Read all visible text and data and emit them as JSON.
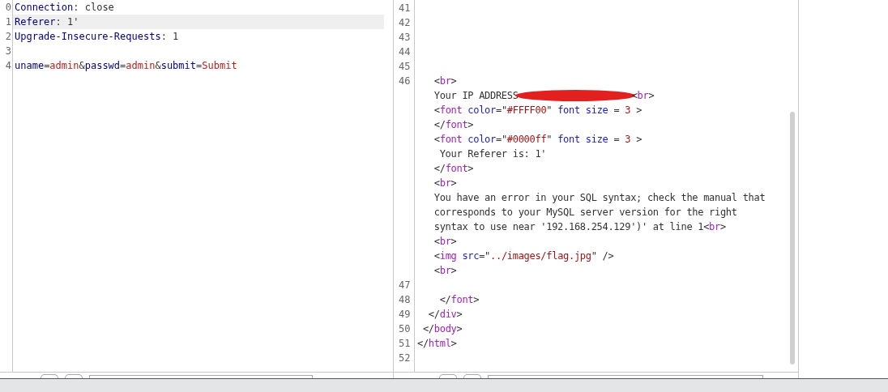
{
  "request_editor": {
    "lines": [
      {
        "number": "0",
        "selected": false,
        "tokens": [
          {
            "kind": "key",
            "text": "Connection"
          },
          {
            "kind": "punct",
            "text": ": "
          },
          {
            "kind": "plain",
            "text": "close"
          }
        ]
      },
      {
        "number": "1",
        "selected": true,
        "tokens": [
          {
            "kind": "key",
            "text": "Referer"
          },
          {
            "kind": "punct",
            "text": ": "
          },
          {
            "kind": "plain",
            "text": "1'"
          }
        ]
      },
      {
        "number": "2",
        "selected": false,
        "tokens": [
          {
            "kind": "key",
            "text": "Upgrade-Insecure-Requests"
          },
          {
            "kind": "punct",
            "text": ": "
          },
          {
            "kind": "plain",
            "text": "1"
          }
        ]
      },
      {
        "number": "3",
        "selected": false
      },
      {
        "number": "4",
        "selected": false,
        "tokens": [
          {
            "kind": "key",
            "text": "uname"
          },
          {
            "kind": "punct",
            "text": "="
          },
          {
            "kind": "value",
            "text": "admin"
          },
          {
            "kind": "punct",
            "text": "&"
          },
          {
            "kind": "key",
            "text": "passwd"
          },
          {
            "kind": "punct",
            "text": "="
          },
          {
            "kind": "value",
            "text": "admin"
          },
          {
            "kind": "punct",
            "text": "&"
          },
          {
            "kind": "key",
            "text": "submit"
          },
          {
            "kind": "punct",
            "text": "="
          },
          {
            "kind": "value",
            "text": "Submit"
          }
        ]
      }
    ]
  },
  "response_editor": {
    "lines": [
      {
        "number": "41"
      },
      {
        "number": "42"
      },
      {
        "number": "43"
      },
      {
        "number": "44"
      },
      {
        "number": "45"
      },
      {
        "number": "46",
        "tokens": [
          {
            "kind": "plain",
            "text": "   <"
          },
          {
            "kind": "tag",
            "text": "br"
          },
          {
            "kind": "plain",
            "text": ">"
          }
        ]
      },
      {
        "tokens": [
          {
            "kind": "plain",
            "text": "   Your IP ADDRESS"
          },
          {
            "kind": "redaction"
          },
          {
            "kind": "plain",
            "text": "<"
          },
          {
            "kind": "tag",
            "text": "br"
          },
          {
            "kind": "plain",
            "text": ">"
          }
        ]
      },
      {
        "tokens": [
          {
            "kind": "plain",
            "text": "   <"
          },
          {
            "kind": "tag",
            "text": "font"
          },
          {
            "kind": "attr",
            "text": " color"
          },
          {
            "kind": "plain",
            "text": "=\""
          },
          {
            "kind": "value",
            "text": "#FFFF00"
          },
          {
            "kind": "plain",
            "text": "\" "
          },
          {
            "kind": "attr",
            "text": "font size"
          },
          {
            "kind": "plain",
            "text": " = "
          },
          {
            "kind": "value",
            "text": "3"
          },
          {
            "kind": "plain",
            "text": " >"
          }
        ]
      },
      {
        "tokens": [
          {
            "kind": "plain",
            "text": "   </"
          },
          {
            "kind": "tag",
            "text": "font"
          },
          {
            "kind": "plain",
            "text": ">"
          }
        ]
      },
      {
        "tokens": [
          {
            "kind": "plain",
            "text": "   <"
          },
          {
            "kind": "tag",
            "text": "font"
          },
          {
            "kind": "attr",
            "text": " color"
          },
          {
            "kind": "plain",
            "text": "=\""
          },
          {
            "kind": "value",
            "text": "#0000ff"
          },
          {
            "kind": "plain",
            "text": "\" "
          },
          {
            "kind": "attr",
            "text": "font size"
          },
          {
            "kind": "plain",
            "text": " = "
          },
          {
            "kind": "value",
            "text": "3"
          },
          {
            "kind": "plain",
            "text": " >"
          }
        ]
      },
      {
        "tokens": [
          {
            "kind": "plain",
            "text": "    Your Referer is: 1'"
          }
        ]
      },
      {
        "tokens": [
          {
            "kind": "plain",
            "text": "   </"
          },
          {
            "kind": "tag",
            "text": "font"
          },
          {
            "kind": "plain",
            "text": ">"
          }
        ]
      },
      {
        "tokens": [
          {
            "kind": "plain",
            "text": "   <"
          },
          {
            "kind": "tag",
            "text": "br"
          },
          {
            "kind": "plain",
            "text": ">"
          }
        ]
      },
      {
        "tokens": [
          {
            "kind": "plain",
            "text": "   You have an error in your SQL syntax; check the manual that"
          }
        ]
      },
      {
        "tokens": [
          {
            "kind": "plain",
            "text": "   corresponds to your MySQL server version for the right"
          }
        ]
      },
      {
        "tokens": [
          {
            "kind": "plain",
            "text": "   syntax to use near '192.168.254.129')' at line 1<"
          },
          {
            "kind": "tag",
            "text": "br"
          },
          {
            "kind": "plain",
            "text": ">"
          }
        ]
      },
      {
        "tokens": [
          {
            "kind": "plain",
            "text": "   <"
          },
          {
            "kind": "tag",
            "text": "br"
          },
          {
            "kind": "plain",
            "text": ">"
          }
        ]
      },
      {
        "tokens": [
          {
            "kind": "plain",
            "text": "   <"
          },
          {
            "kind": "tag",
            "text": "img"
          },
          {
            "kind": "attr",
            "text": " src"
          },
          {
            "kind": "plain",
            "text": "=\""
          },
          {
            "kind": "value",
            "text": "../images/flag.jpg"
          },
          {
            "kind": "plain",
            "text": "\" />"
          }
        ]
      },
      {
        "tokens": [
          {
            "kind": "plain",
            "text": "   <"
          },
          {
            "kind": "tag",
            "text": "br"
          },
          {
            "kind": "plain",
            "text": ">"
          }
        ]
      },
      {
        "number": "47"
      },
      {
        "number": "48",
        "tokens": [
          {
            "kind": "plain",
            "text": "    </"
          },
          {
            "kind": "tag",
            "text": "font"
          },
          {
            "kind": "plain",
            "text": ">"
          }
        ]
      },
      {
        "number": "49",
        "tokens": [
          {
            "kind": "plain",
            "text": "  </"
          },
          {
            "kind": "tag",
            "text": "div"
          },
          {
            "kind": "plain",
            "text": ">"
          }
        ]
      },
      {
        "number": "50",
        "tokens": [
          {
            "kind": "plain",
            "text": " </"
          },
          {
            "kind": "tag",
            "text": "body"
          },
          {
            "kind": "plain",
            "text": ">"
          }
        ]
      },
      {
        "number": "51",
        "tokens": [
          {
            "kind": "plain",
            "text": "</"
          },
          {
            "kind": "tag",
            "text": "html"
          },
          {
            "kind": "plain",
            "text": ">"
          }
        ]
      },
      {
        "number": "52"
      }
    ]
  }
}
